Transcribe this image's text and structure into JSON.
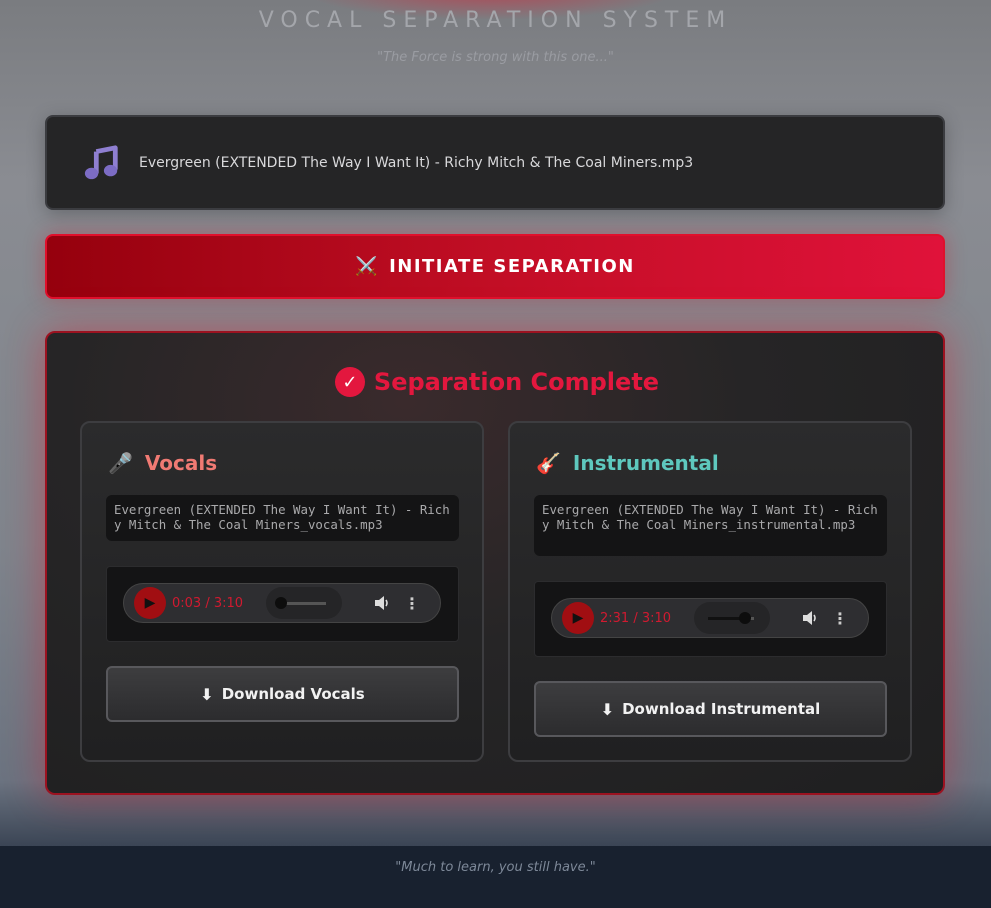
{
  "header": {
    "title": "VOCAL SEPARATION SYSTEM",
    "tagline": "\"The Force is strong with this one...\""
  },
  "file": {
    "icon": "music-note-icon",
    "name": "Evergreen (EXTENDED The Way I Want It) - Richy Mitch & The Coal Miners.mp3"
  },
  "separate_button": {
    "icon": "crossed-swords-icon",
    "label": "INITIATE SEPARATION"
  },
  "result": {
    "title": "Separation Complete",
    "accent_color": "#e3173e",
    "tracks": [
      {
        "title": "Vocals",
        "icon": "microphone-icon",
        "color": "#f07a73",
        "filename": "Evergreen (EXTENDED The Way I Want It) - Richy Mitch & The Coal Miners_vocals.mp3",
        "time": "0:03 / 3:10",
        "progress": 0.016,
        "download_label": "Download Vocals"
      },
      {
        "title": "Instrumental",
        "icon": "guitar-icon",
        "color": "#5ec8be",
        "filename": "Evergreen (EXTENDED The Way I Want It) - Richy Mitch & The Coal Miners_instrumental.mp3",
        "time": "2:31 / 3:10",
        "progress": 0.795,
        "download_label": "Download Instrumental"
      }
    ]
  },
  "footer": {
    "text": "\"Much to learn, you still have.\""
  }
}
